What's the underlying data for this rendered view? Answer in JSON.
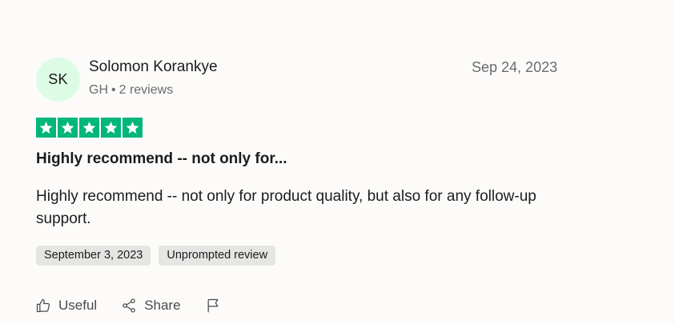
{
  "reviewer": {
    "initials": "SK",
    "name": "Solomon Korankye",
    "country": "GH",
    "separator": "•",
    "review_count": "2 reviews",
    "avatar_color": "#dcfce5"
  },
  "review": {
    "date_posted": "Sep 24, 2023",
    "rating": 5,
    "rating_max": 5,
    "star_color": "#00b67a",
    "title": "Highly recommend -- not only for...",
    "body": "Highly recommend -- not only for product quality, but also for any follow-up support.",
    "tags": [
      "September 3, 2023",
      "Unprompted review"
    ]
  },
  "actions": {
    "useful_label": "Useful",
    "useful_icon": "thumbs-up-icon",
    "share_label": "Share",
    "share_icon": "share-icon",
    "flag_icon": "flag-icon"
  }
}
